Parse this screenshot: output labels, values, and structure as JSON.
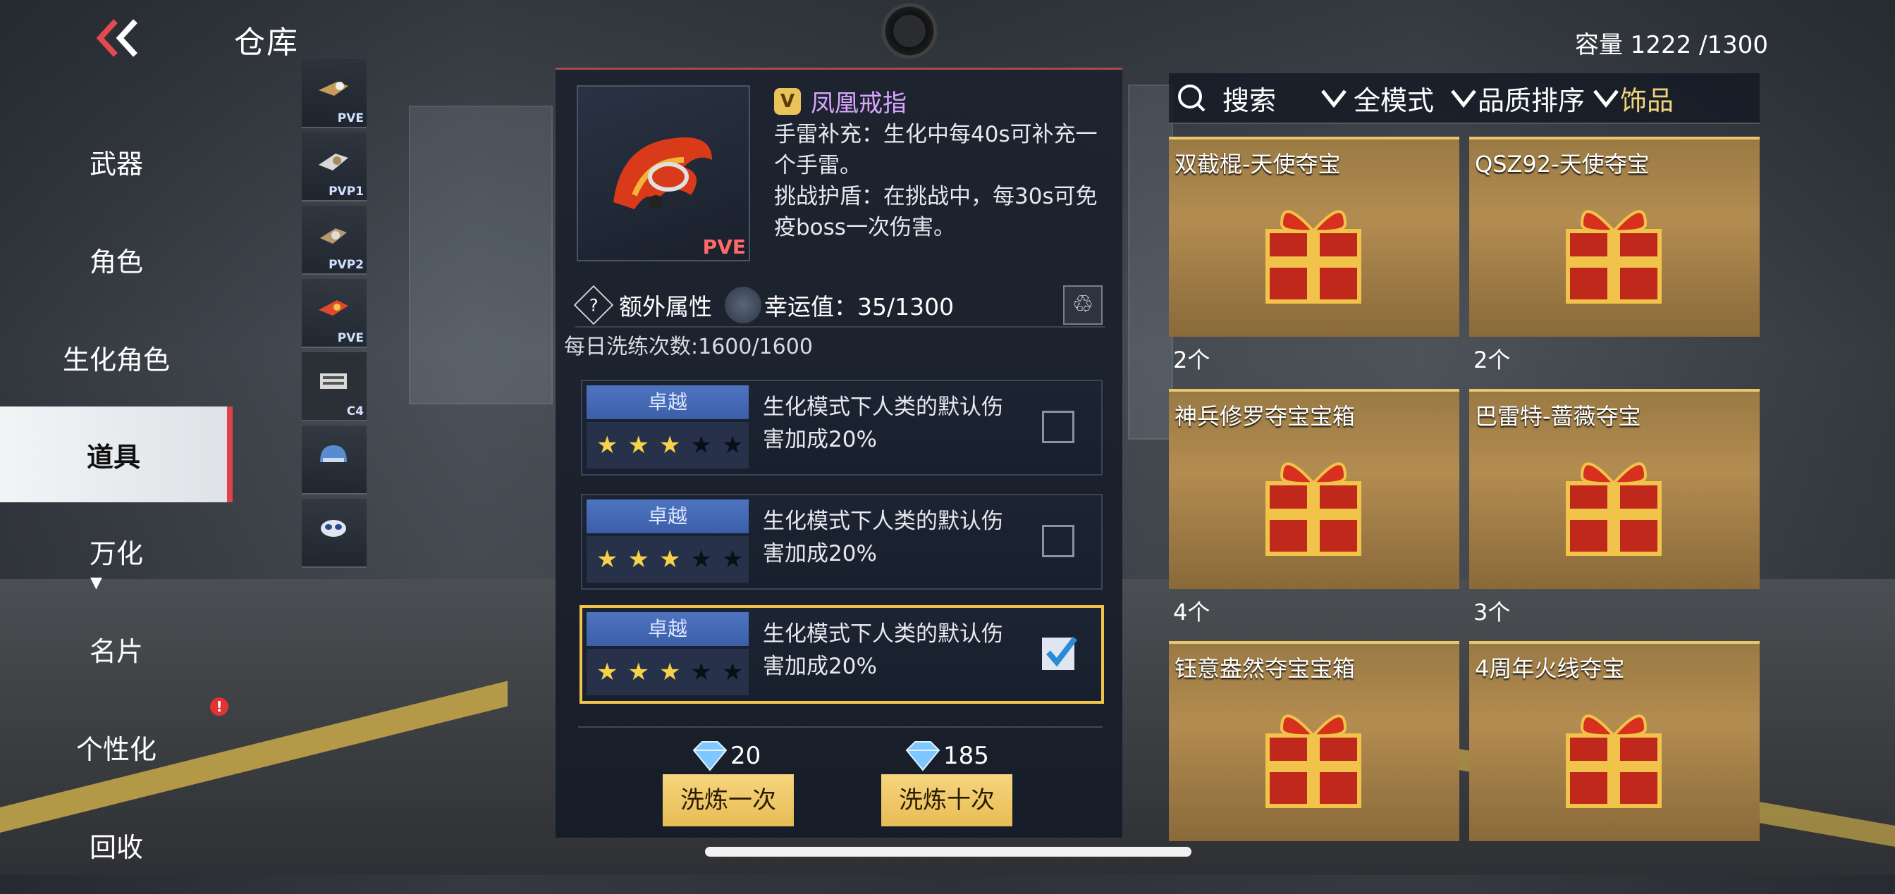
{
  "header": {
    "title": "仓库",
    "capacity": "容量 1222 /1300"
  },
  "nav": {
    "items": [
      {
        "label": "武器"
      },
      {
        "label": "角色"
      },
      {
        "label": "生化角色"
      },
      {
        "label": "道具",
        "active": true
      },
      {
        "label": "万化"
      },
      {
        "label": "名片"
      },
      {
        "label": "个性化",
        "alert": "!"
      },
      {
        "label": "回收"
      }
    ]
  },
  "thumbs": [
    {
      "tag": "PVE"
    },
    {
      "tag": "PVP1"
    },
    {
      "tag": "PVP2"
    },
    {
      "tag": "PVE"
    },
    {
      "tag": "C4",
      "selected": true
    },
    {
      "tag": ""
    },
    {
      "tag": ""
    }
  ],
  "detail": {
    "badge": "V",
    "name": "凤凰戒指",
    "mode_tag": "PVE",
    "desc_line1": "手雷补充：生化中每40s可补充一个手雷。",
    "desc_line2": "挑战护盾：在挑战中，每30s可免疫boss一次伤害。",
    "extra_label": "额外属性",
    "luck": "幸运值：35/1300",
    "daily": "每日洗练次数:1600/1600",
    "attributes": [
      {
        "quality": "卓越",
        "stars_on": 3,
        "stars_total": 5,
        "text": "生化模式下人类的默认伤害加成20%",
        "checked": false
      },
      {
        "quality": "卓越",
        "stars_on": 3,
        "stars_total": 5,
        "text": "生化模式下人类的默认伤害加成20%",
        "checked": false
      },
      {
        "quality": "卓越",
        "stars_on": 3,
        "stars_total": 5,
        "text": "生化模式下人类的默认伤害加成20%",
        "checked": true
      }
    ],
    "cost_once": "20",
    "cost_ten": "185",
    "btn_once": "洗炼一次",
    "btn_ten": "洗炼十次"
  },
  "filter": {
    "search": "搜索",
    "mode": "全模式",
    "sort": "品质排序",
    "category": "饰品"
  },
  "items": [
    {
      "name": "双截棍-天使夺宝",
      "count": "2个"
    },
    {
      "name": "QSZ92-天使夺宝",
      "count": "2个"
    },
    {
      "name": "神兵修罗夺宝宝箱",
      "count": "4个"
    },
    {
      "name": "巴雷特-蔷薇夺宝",
      "count": "3个"
    },
    {
      "name": "钰意盎然夺宝宝箱",
      "count": ""
    },
    {
      "name": "4周年火线夺宝",
      "count": ""
    }
  ],
  "colors": {
    "accent_gold": "#f2c34a",
    "active_nav_bar": "#e2404a",
    "item_name": "#d9a6ff",
    "mode_tag": "#ff6a6a"
  }
}
